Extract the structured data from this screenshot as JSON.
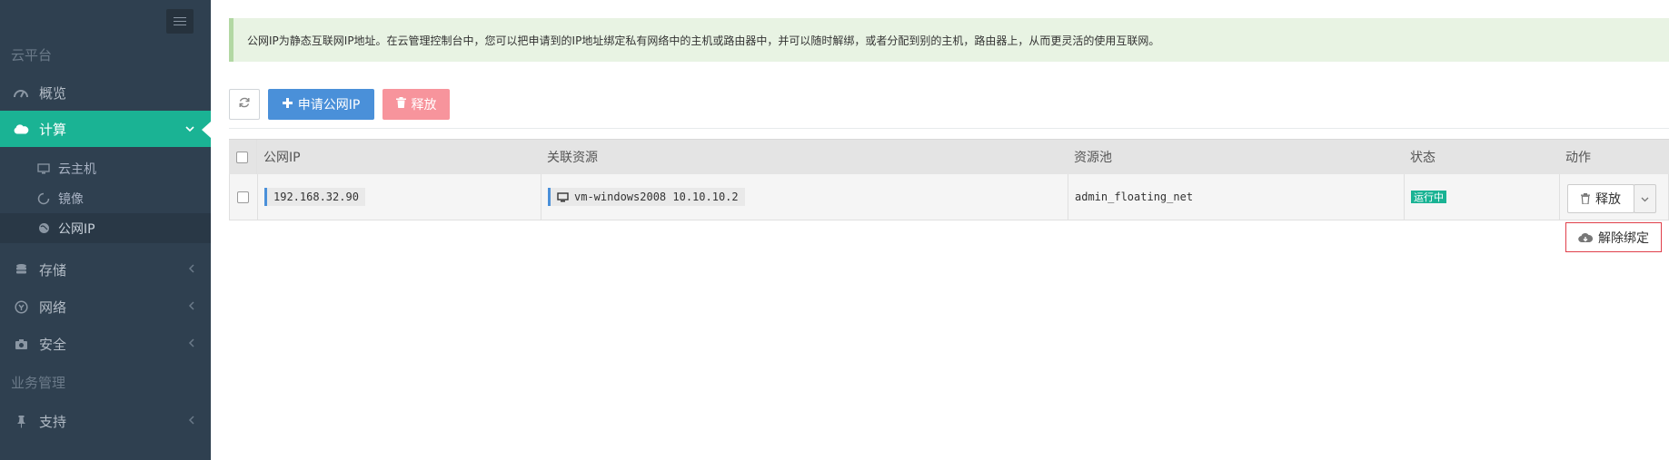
{
  "sidebar": {
    "section_cloud": "云平台",
    "section_business": "业务管理",
    "items": [
      {
        "label": "概览",
        "icon": "dashboard-icon"
      },
      {
        "label": "计算",
        "icon": "cloud-icon"
      },
      {
        "label": "存储",
        "icon": "database-icon"
      },
      {
        "label": "网络",
        "icon": "network-icon"
      },
      {
        "label": "安全",
        "icon": "camera-icon"
      },
      {
        "label": "支持",
        "icon": "thumbtack-icon"
      }
    ],
    "subitems": [
      {
        "label": "云主机",
        "icon": "desktop-icon"
      },
      {
        "label": "镜像",
        "icon": "circle-icon"
      },
      {
        "label": "公网IP",
        "icon": "globe-icon"
      }
    ]
  },
  "alert": {
    "text": "公网IP为静态互联网IP地址。在云管理控制台中，您可以把申请到的IP地址绑定私有网络中的主机或路由器中，并可以随时解绑，或者分配到别的主机，路由器上，从而更灵活的使用互联网。"
  },
  "toolbar": {
    "apply_label": "申请公网IP",
    "release_label": "释放"
  },
  "table": {
    "columns": [
      "公网IP",
      "关联资源",
      "资源池",
      "状态",
      "动作"
    ],
    "rows": [
      {
        "ip": "192.168.32.90",
        "resource": "vm-windows2008 10.10.10.2",
        "pool": "admin_floating_net",
        "status": "运行中",
        "action": "释放"
      }
    ]
  },
  "dropdown": {
    "item_label": "解除绑定"
  },
  "colors": {
    "sidebar_bg": "#2f4050",
    "active": "#1ab394",
    "primary": "#4a90d9",
    "danger": "#f7949c",
    "alert_bg": "#e8f3e3",
    "highlight_border": "#e03f4a"
  }
}
